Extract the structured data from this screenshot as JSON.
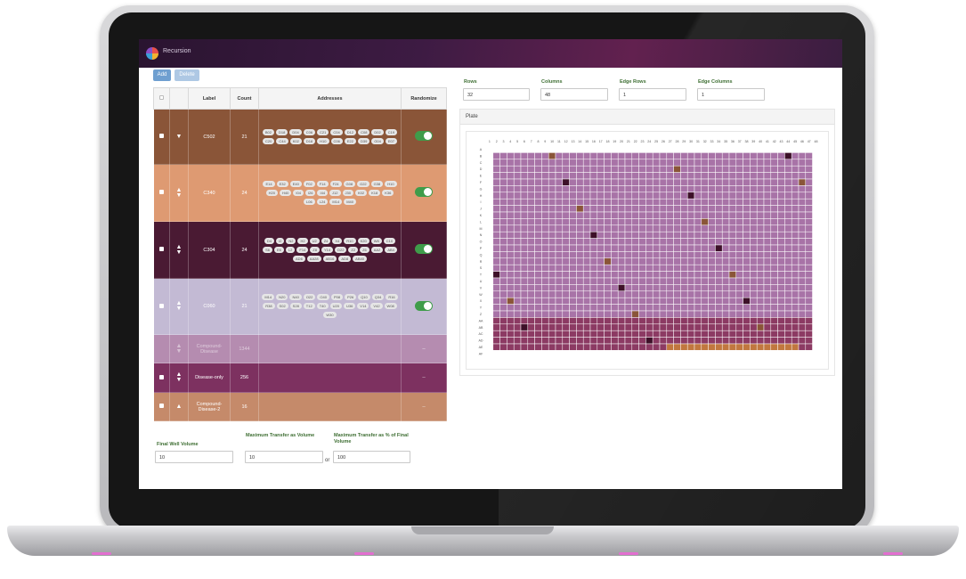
{
  "app": {
    "title": "Recursion"
  },
  "toolbar": {
    "add_label": "Add",
    "delete_label": "Delete"
  },
  "table": {
    "headers": {
      "label": "Label",
      "count": "Count",
      "addresses": "Addresses",
      "randomize": "Randomize"
    },
    "rows": [
      {
        "label": "C502",
        "count": "21",
        "bg": "#8a5538",
        "randomize": true,
        "arrows": "down",
        "chips": [
          "B02",
          "D18",
          "D04",
          "C06",
          "C21",
          "C04",
          "D12",
          "C08",
          "D02",
          "C19",
          "C20",
          "C44",
          "K02",
          "D18",
          "H10",
          "C06",
          "E22",
          "D39",
          "G04",
          "E07"
        ]
      },
      {
        "label": "C340",
        "count": "24",
        "bg": "#de9a72",
        "randomize": true,
        "arrows": "updown",
        "chips": [
          "E14",
          "E32",
          "E40",
          "F02",
          "F14",
          "F24",
          "G08",
          "G22",
          "G38",
          "H10",
          "H20",
          "H40",
          "I04",
          "I26",
          "I44",
          "J12",
          "J30",
          "K02",
          "K18",
          "K36",
          "L06",
          "L24",
          "M14",
          "M40"
        ]
      },
      {
        "label": "C304",
        "count": "24",
        "bg": "#4a1a33",
        "randomize": true,
        "arrows": "updown",
        "chips": [
          "D4",
          "I2",
          "N2",
          "H2",
          "U2",
          "Z4",
          "X4",
          "R10",
          "K20",
          "W8",
          "C10",
          "S6",
          "E6",
          "L2",
          "F14",
          "Z8",
          "Y14",
          "D22",
          "Z2",
          "Z6",
          "AA2",
          "AB4",
          "AD6",
          "AA28",
          "AB16",
          "AD8",
          "AB40"
        ]
      },
      {
        "label": "C060",
        "count": "21",
        "bg": "#c3bad4",
        "randomize": true,
        "arrows": "updown",
        "chips": [
          "M14",
          "N20",
          "N40",
          "O22",
          "O40",
          "P08",
          "P26",
          "Q10",
          "Q34",
          "R16",
          "R38",
          "S02",
          "S28",
          "T12",
          "T40",
          "U20",
          "U36",
          "V14",
          "V42",
          "W08",
          "W30"
        ]
      },
      {
        "label": "Compound-Disease",
        "count": "1344",
        "bg": "#b58cb0",
        "randomize": false,
        "arrows": "updown-faded",
        "chips": []
      },
      {
        "label": "Disease-only",
        "count": "256",
        "bg": "#7d3160",
        "randomize": false,
        "arrows": "updown",
        "chips": []
      },
      {
        "label": "Compound-Disease-2",
        "count": "16",
        "bg": "#c58a6a",
        "randomize": false,
        "arrows": "up",
        "chips": []
      }
    ]
  },
  "volumes": {
    "final_well_label": "Final Well Volume",
    "final_well_value": "10",
    "max_transfer_label": "Maximum Transfer as Volume",
    "max_transfer_value": "10",
    "or_label": "or",
    "max_transfer_pct_label": "Maximum Transfer as % of Final Volume",
    "max_transfer_pct_value": "100"
  },
  "plate_config": {
    "rows_label": "Rows",
    "rows_value": "32",
    "columns_label": "Columns",
    "columns_value": "48",
    "edge_rows_label": "Edge Rows",
    "edge_rows_value": "1",
    "edge_columns_label": "Edge Columns",
    "edge_columns_value": "1"
  },
  "plate": {
    "title": "Plate",
    "row_labels": [
      "A",
      "B",
      "C",
      "D",
      "E",
      "F",
      "G",
      "H",
      "I",
      "J",
      "K",
      "L",
      "M",
      "N",
      "O",
      "P",
      "Q",
      "R",
      "S",
      "T",
      "U",
      "V",
      "W",
      "X",
      "Y",
      "Z",
      "AA",
      "AB",
      "AC",
      "AD",
      "AE",
      "AF"
    ],
    "colors": {
      "compound_disease": "#a873a7",
      "disease_only": "#8c3a63",
      "compound_disease_2": "#c1773f",
      "c502": "#8a5538",
      "c340": "#e5a06f",
      "c304": "#3d1028",
      "c060": "#c8c3d9",
      "edge": "#ffffff",
      "grid": "#ffffff"
    }
  }
}
